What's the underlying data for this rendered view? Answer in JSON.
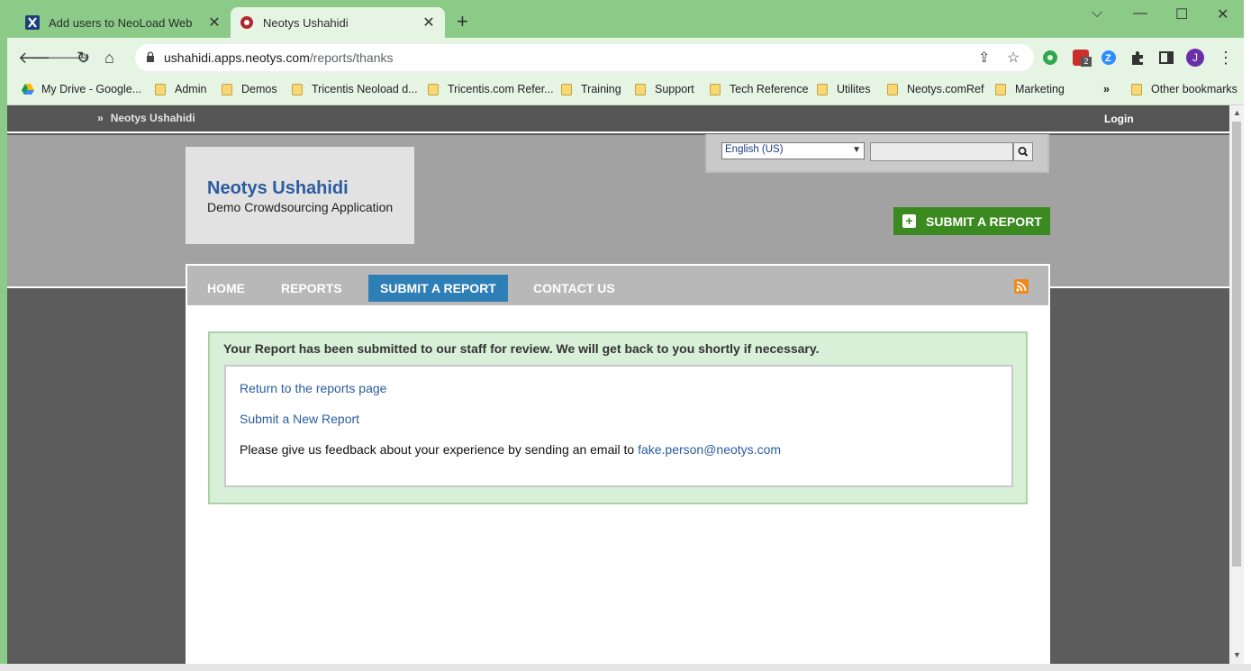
{
  "browser": {
    "tabs": [
      {
        "title": "Add users to NeoLoad Web",
        "active": false
      },
      {
        "title": "Neotys Ushahidi",
        "active": true
      }
    ],
    "url": {
      "host": "ushahidi.apps.neotys.com",
      "path": "/reports/thanks"
    },
    "profile_initial": "J",
    "extension_badge": "2",
    "bookmarks": [
      {
        "label": "My Drive - Google...",
        "icon": "google-drive-icon"
      },
      {
        "label": "Admin",
        "icon": "folder-icon"
      },
      {
        "label": "Demos",
        "icon": "folder-icon"
      },
      {
        "label": "Tricentis Neoload d...",
        "icon": "folder-icon"
      },
      {
        "label": "Tricentis.com Refer...",
        "icon": "folder-icon"
      },
      {
        "label": "Training",
        "icon": "folder-icon"
      },
      {
        "label": "Support",
        "icon": "folder-icon"
      },
      {
        "label": "Tech Reference",
        "icon": "folder-icon"
      },
      {
        "label": "Utilites",
        "icon": "folder-icon"
      },
      {
        "label": "Neotys.comRef",
        "icon": "folder-icon"
      },
      {
        "label": "Marketing",
        "icon": "folder-icon"
      }
    ],
    "overflow_label": "»",
    "other_bookmarks": "Other bookmarks"
  },
  "site": {
    "topbar": {
      "breadcrumb_arrow": "»",
      "breadcrumb": "Neotys Ushahidi",
      "login": "Login"
    },
    "name": "Neotys Ushahidi",
    "tagline": "Demo Crowdsourcing Application",
    "language_selected": "English (US)",
    "submit_button": "SUBMIT A REPORT",
    "nav": [
      {
        "label": "HOME",
        "active": false
      },
      {
        "label": "REPORTS",
        "active": false
      },
      {
        "label": "SUBMIT A REPORT",
        "active": true
      },
      {
        "label": "CONTACT US",
        "active": false
      }
    ],
    "message": {
      "heading": "Your Report has been submitted to our staff for review. We will get back to you shortly if necessary.",
      "return_link": "Return to the reports page",
      "new_report_link": "Submit a New Report",
      "feedback_text": "Please give us feedback about your experience by sending an email to",
      "email": "fake.person@neotys.com"
    }
  },
  "colors": {
    "chrome": "#8ccb87",
    "link": "#2b5ca0",
    "submit_green": "#3b8a1f",
    "nav_active": "#2f7fb7",
    "message_bg": "#d8efd8"
  }
}
